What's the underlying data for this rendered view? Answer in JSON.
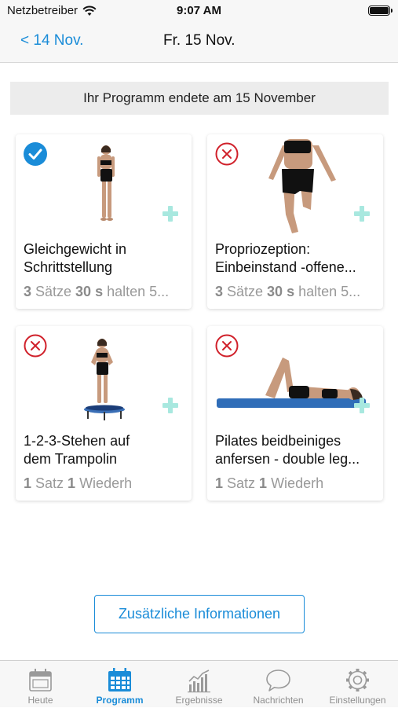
{
  "status_bar": {
    "carrier": "Netzbetreiber",
    "time": "9:07 AM"
  },
  "nav": {
    "back_label": "< 14 Nov.",
    "title": "Fr. 15 Nov."
  },
  "banner": "Ihr Programm endete am 15 November",
  "exercises": [
    {
      "name_line1": "Gleichgewicht in",
      "name_line2": "Schrittstellung",
      "dose": [
        {
          "text": "3",
          "bold": true
        },
        {
          "text": " Sätze ",
          "bold": false
        },
        {
          "text": "30 s",
          "bold": true
        },
        {
          "text": " halten 5...",
          "bold": false
        }
      ],
      "completed": true
    },
    {
      "name_line1": "Propriozeption:",
      "name_line2": "Einbeinstand -offene...",
      "dose": [
        {
          "text": "3",
          "bold": true
        },
        {
          "text": " Sätze ",
          "bold": false
        },
        {
          "text": "30 s",
          "bold": true
        },
        {
          "text": " halten 5...",
          "bold": false
        }
      ],
      "completed": false
    },
    {
      "name_line1": "1-2-3-Stehen auf",
      "name_line2": "dem Trampolin",
      "dose": [
        {
          "text": "1",
          "bold": true
        },
        {
          "text": " Satz ",
          "bold": false
        },
        {
          "text": "1",
          "bold": true
        },
        {
          "text": " Wiederh",
          "bold": false
        }
      ],
      "completed": false
    },
    {
      "name_line1": "Pilates beidbeiniges",
      "name_line2": "anfersen - double leg...",
      "dose": [
        {
          "text": "1",
          "bold": true
        },
        {
          "text": " Satz ",
          "bold": false
        },
        {
          "text": "1",
          "bold": true
        },
        {
          "text": " Wiederh",
          "bold": false
        }
      ],
      "completed": false
    }
  ],
  "info_button": "Zusätzliche Informationen",
  "tabs": [
    {
      "label": "Heute",
      "icon": "calendar-icon",
      "active": false
    },
    {
      "label": "Programm",
      "icon": "calendar-grid-icon",
      "active": true
    },
    {
      "label": "Ergebnisse",
      "icon": "bar-chart-icon",
      "active": false
    },
    {
      "label": "Nachrichten",
      "icon": "chat-bubble-icon",
      "active": false
    },
    {
      "label": "Einstellungen",
      "icon": "gear-icon",
      "active": false
    }
  ],
  "colors": {
    "accent": "#1a8cd8",
    "done": "#1a8cd8",
    "not_done": "#d0202a",
    "add": "#a8e8df",
    "muted": "#999999"
  }
}
